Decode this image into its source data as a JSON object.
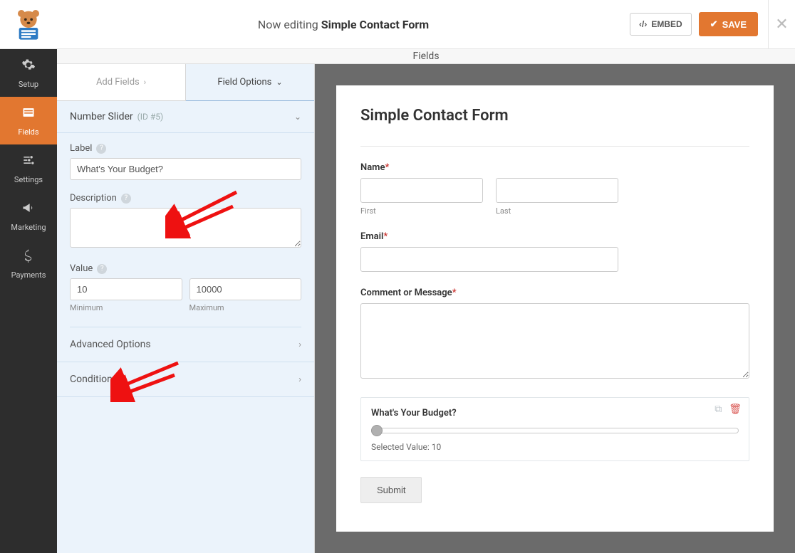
{
  "header": {
    "editing_prefix": "Now editing",
    "form_title": "Simple Contact Form",
    "embed_label": "EMBED",
    "save_label": "SAVE"
  },
  "sidebar": {
    "items": [
      {
        "label": "Setup"
      },
      {
        "label": "Fields"
      },
      {
        "label": "Settings"
      },
      {
        "label": "Marketing"
      },
      {
        "label": "Payments"
      }
    ]
  },
  "panel": {
    "fields_header": "Fields",
    "tabs": {
      "add": "Add Fields",
      "options": "Field Options"
    },
    "section": {
      "name": "Number Slider",
      "id": "(ID #5)"
    },
    "label_field": {
      "label": "Label",
      "value": "What's Your Budget?"
    },
    "description_field": {
      "label": "Description",
      "value": ""
    },
    "value_field": {
      "label": "Value",
      "min_value": "10",
      "min_label": "Minimum",
      "max_value": "10000",
      "max_label": "Maximum"
    },
    "adv": "Advanced Options",
    "cond": "Conditionals"
  },
  "preview": {
    "title": "Simple Contact Form",
    "name": {
      "label": "Name",
      "first": "First",
      "last": "Last"
    },
    "email": {
      "label": "Email"
    },
    "comment": {
      "label": "Comment or Message"
    },
    "slider": {
      "label": "What's Your Budget?",
      "selected_label": "Selected Value:",
      "selected_value": "10"
    },
    "submit": "Submit"
  }
}
